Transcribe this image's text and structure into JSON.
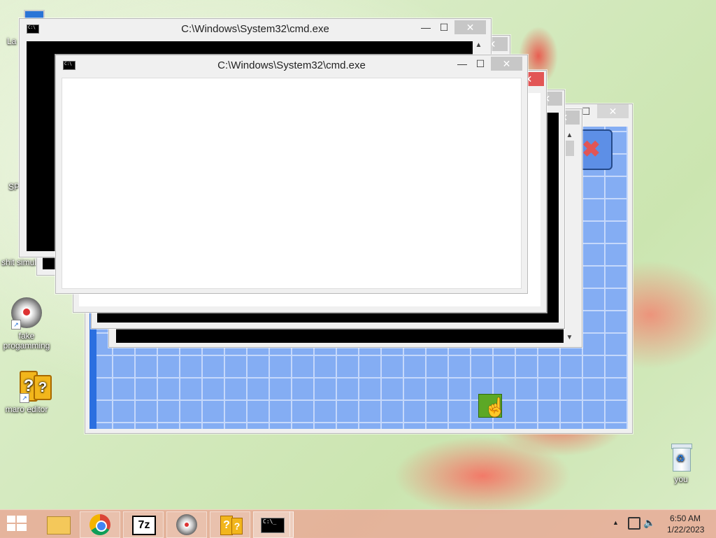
{
  "desktop": {
    "icons": [
      {
        "label": "La",
        "icon": "computer-icon"
      },
      {
        "label": "",
        "icon": "app-shortcut-icon"
      },
      {
        "label": "SP",
        "icon": "app-shortcut-icon"
      },
      {
        "label": "shit simul",
        "icon": "app-shortcut-icon"
      },
      {
        "label": "fake progamming",
        "icon": "app-shortcut-icon"
      },
      {
        "label": "maro editor",
        "icon": "question-block-icon"
      }
    ],
    "recycle_bin_label": "you"
  },
  "windows": {
    "cmd_back": {
      "title": "C:\\Windows\\System32\\cmd.exe"
    },
    "cmd_front": {
      "title": "C:\\Windows\\System32\\cmd.exe"
    },
    "buttons": {
      "minimize": "—",
      "maximize": "☐",
      "close": "✕"
    }
  },
  "taskbar": {
    "apps": [
      "file-explorer-icon",
      "chrome-icon",
      "7zip-icon",
      "app-icon",
      "question-block-icon",
      "cmd-icon"
    ],
    "sevenzip_label": "7z",
    "cmd_label": "C:\\_"
  },
  "tray": {
    "time": "6:50 AM",
    "date": "1/22/2023",
    "show_hidden": "▲"
  },
  "colors": {
    "accent_red": "#e25555",
    "grid_blue": "#84adf3",
    "taskbar": "#e8aa96"
  }
}
